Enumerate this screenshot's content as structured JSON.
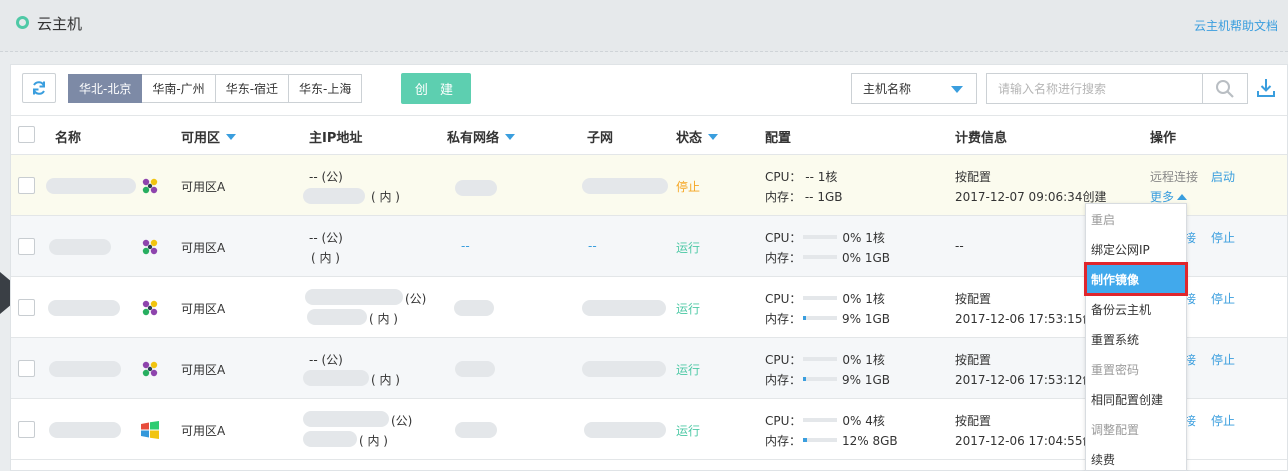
{
  "header": {
    "title": "云主机",
    "help_link": "云主机帮助文档"
  },
  "toolbar": {
    "regions": [
      "华北-北京",
      "华南-广州",
      "华东-宿迁",
      "华东-上海"
    ],
    "active_region": "华北-北京",
    "create_label": "创 建",
    "filter_select": "主机名称",
    "search_placeholder": "请输入名称进行搜索"
  },
  "table": {
    "headers": {
      "name": "名称",
      "zone": "可用区",
      "ip": "主IP地址",
      "vpc": "私有网络",
      "subnet": "子网",
      "status": "状态",
      "config": "配置",
      "billing": "计费信息",
      "ops": "操作"
    },
    "rows": [
      {
        "zone": "可用区A",
        "ip_pub": "-- (公)",
        "ip_priv": "( 内 )",
        "vpc": "",
        "subnet": "",
        "status": "停止",
        "cpu_label": "CPU：",
        "cpu": "-- 1核",
        "mem_label": "内存：",
        "mem": "-- 1GB",
        "billing_type": "按配置",
        "billing_time": "2017-12-07 09:06:34创建",
        "op1": "远程连接",
        "op2": "启动",
        "more": "更多"
      },
      {
        "zone": "可用区A",
        "ip_pub": "-- (公)",
        "ip_priv": "( 内 )",
        "vpc": "--",
        "subnet": "--",
        "status": "运行",
        "cpu_label": "CPU：",
        "cpu": "0% 1核",
        "cpu_pct": 0,
        "mem_label": "内存：",
        "mem": "0% 1GB",
        "mem_pct": 0,
        "billing_type": "--",
        "billing_time": "",
        "op1": "接",
        "op2": "停止"
      },
      {
        "zone": "可用区A",
        "ip_pub": "(公)",
        "ip_priv": "( 内 )",
        "vpc": "",
        "subnet": "",
        "status": "运行",
        "cpu_label": "CPU：",
        "cpu": "0% 1核",
        "cpu_pct": 0,
        "mem_label": "内存：",
        "mem": "9% 1GB",
        "mem_pct": 9,
        "billing_type": "按配置",
        "billing_time": "2017-12-06 17:53:15创",
        "op1": "接",
        "op2": "停止"
      },
      {
        "zone": "可用区A",
        "ip_pub": "-- (公)",
        "ip_priv": "( 内 )",
        "vpc": "",
        "subnet": "",
        "status": "运行",
        "cpu_label": "CPU：",
        "cpu": "0% 1核",
        "cpu_pct": 0,
        "mem_label": "内存：",
        "mem": "9% 1GB",
        "mem_pct": 9,
        "billing_type": "按配置",
        "billing_time": "2017-12-06 17:53:12创",
        "op1": "接",
        "op2": "停止"
      },
      {
        "zone": "可用区A",
        "ip_pub": "(公)",
        "ip_priv": "( 内 )",
        "vpc": "",
        "subnet": "",
        "status": "运行",
        "cpu_label": "CPU：",
        "cpu": "0% 4核",
        "cpu_pct": 0,
        "mem_label": "内存：",
        "mem": "12% 8GB",
        "mem_pct": 12,
        "billing_type": "按配置",
        "billing_time": "2017-12-06 17:04:55创",
        "op1": "接",
        "op2": "停止"
      }
    ]
  },
  "more_menu": {
    "items": [
      {
        "label": "重启",
        "disabled": true
      },
      {
        "label": "绑定公网IP",
        "disabled": false
      },
      {
        "label": "制作镜像",
        "disabled": false,
        "active": true
      },
      {
        "label": "备份云主机",
        "disabled": false
      },
      {
        "label": "重置系统",
        "disabled": false
      },
      {
        "label": "重置密码",
        "disabled": true
      },
      {
        "label": "相同配置创建",
        "disabled": false
      },
      {
        "label": "调整配置",
        "disabled": true
      },
      {
        "label": "续费",
        "disabled": false
      }
    ]
  },
  "colors": {
    "accent": "#3a9ede",
    "create": "#5dcfb0",
    "stop": "#f5a623",
    "run": "#4fc9a6",
    "highlight": "#e0262c"
  }
}
